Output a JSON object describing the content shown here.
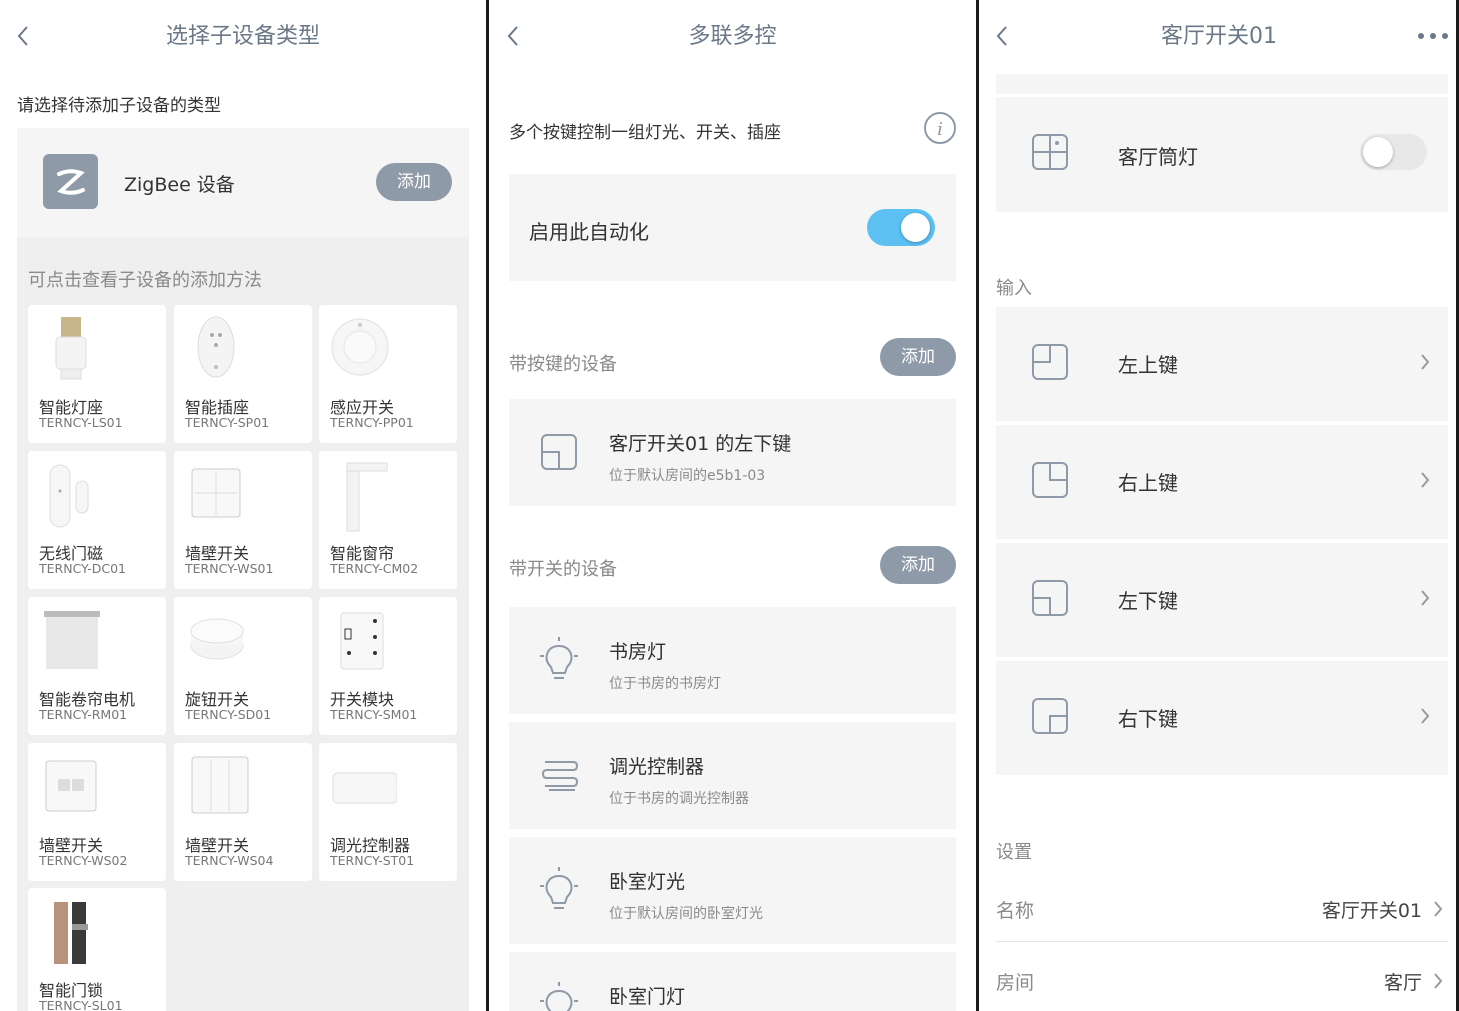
{
  "screen1": {
    "title": "选择子设备类型",
    "prompt": "请选择待添加子设备的类型",
    "zigbee": {
      "label": "ZigBee 设备",
      "add": "添加"
    },
    "hint": "可点击查看子设备的添加方法",
    "devices": [
      {
        "name": "智能灯座",
        "model": "TERNCY-LS01",
        "icon": "bulb-socket-icon"
      },
      {
        "name": "智能插座",
        "model": "TERNCY-SP01",
        "icon": "plug-icon"
      },
      {
        "name": "感应开关",
        "model": "TERNCY-PP01",
        "icon": "motion-switch-icon"
      },
      {
        "name": "无线门磁",
        "model": "TERNCY-DC01",
        "icon": "door-sensor-icon"
      },
      {
        "name": "墙壁开关",
        "model": "TERNCY-WS01",
        "icon": "wall-switch-icon"
      },
      {
        "name": "智能窗帘",
        "model": "TERNCY-CM02",
        "icon": "curtain-icon"
      },
      {
        "name": "智能卷帘电机",
        "model": "TERNCY-RM01",
        "icon": "roller-blind-icon"
      },
      {
        "name": "旋钮开关",
        "model": "TERNCY-SD01",
        "icon": "knob-switch-icon"
      },
      {
        "name": "开关模块",
        "model": "TERNCY-SM01",
        "icon": "switch-module-icon"
      },
      {
        "name": "墙壁开关",
        "model": "TERNCY-WS02",
        "icon": "wall-switch-2-icon"
      },
      {
        "name": "墙壁开关",
        "model": "TERNCY-WS04",
        "icon": "wall-switch-4-icon"
      },
      {
        "name": "调光控制器",
        "model": "TERNCY-ST01",
        "icon": "dimmer-icon"
      },
      {
        "name": "智能门锁",
        "model": "TERNCY-SL01",
        "icon": "door-lock-icon"
      }
    ]
  },
  "screen2": {
    "title": "多联多控",
    "description": "多个按键控制一组灯光、开关、插座",
    "enable_label": "启用此自动化",
    "enabled": true,
    "keyed_section": "带按键的设备",
    "add": "添加",
    "keyed_device": {
      "title": "客厅开关01 的左下键",
      "subtitle": "位于默认房间的e5b1-03"
    },
    "switch_section": "带开关的设备",
    "switch_devices": [
      {
        "title": "书房灯",
        "subtitle": "位于书房的书房灯",
        "icon": "lightbulb-icon"
      },
      {
        "title": "调光控制器",
        "subtitle": "位于书房的调光控制器",
        "icon": "dimmer-icon"
      },
      {
        "title": "卧室灯光",
        "subtitle": "位于默认房间的卧室灯光",
        "icon": "lightbulb-icon"
      },
      {
        "title": "卧室门灯",
        "subtitle": "",
        "icon": "lightbulb-icon"
      }
    ]
  },
  "screen3": {
    "title": "客厅开关01",
    "output_device": {
      "label": "客厅筒灯",
      "on": false
    },
    "input_section": "输入",
    "keys": [
      "左上键",
      "右上键",
      "左下键",
      "右下键"
    ],
    "settings_section": "设置",
    "name_label": "名称",
    "name_value": "客厅开关01",
    "room_label": "房间",
    "room_value": "客厅"
  },
  "colors": {
    "accent_blue": "#5cc0f2",
    "pill_gray": "#8f9aa8",
    "title_gray": "#6b7888"
  }
}
